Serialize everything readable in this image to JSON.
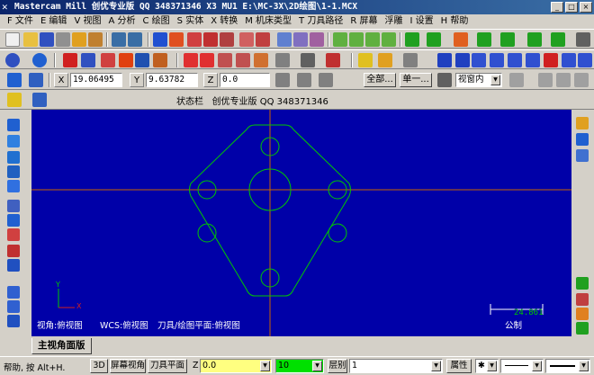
{
  "window": {
    "title": "Mastercam Mill 创优专业版 QQ 348371346 X3 MU1  E:\\MC-3X\\2D绘图\\1-1.MCX",
    "minimize": "_",
    "maximize": "□",
    "close": "×"
  },
  "menu": [
    "F 文件",
    "E 编辑",
    "V 视图",
    "A 分析",
    "C 绘图",
    "S 实体",
    "X 转换",
    "M 机床类型",
    "T 刀具路径",
    "R 屏幕",
    "浮雕",
    "I 设置",
    "H 帮助"
  ],
  "attr": {
    "x_label": "X",
    "x_value": "19.06495",
    "y_label": "Y",
    "y_value": "9.63782",
    "z_label": "Z",
    "z_value": "0.0",
    "all_button": "全部...",
    "single_button": "单一...",
    "window_mode": "视窗内"
  },
  "status_row": {
    "text": "状态栏   创优专业版 QQ 348371346"
  },
  "viewport": {
    "view_label": "视角:俯视图",
    "wcs_label": "WCS:俯视图",
    "plane_label": "刀具/绘图平面:俯视图",
    "scale_value": "24.861",
    "scale_unit": "公制",
    "axis_y": "Y",
    "axis_x": "X",
    "bg_color": "#0000a8",
    "geometry_color": "#00c800",
    "crosshair_color": "#c86400"
  },
  "tab": {
    "label": "主视角面版"
  },
  "bottom": {
    "help": "帮助, 按 Alt+H.",
    "btn_3d": "3D",
    "btn_screen_view": "屏幕视角",
    "btn_tool_plane": "刀具平面",
    "z_label": "Z",
    "z_value": "0.0",
    "color_value": "10",
    "level_label": "层别",
    "level_value": "1",
    "attr_label": "属性"
  }
}
